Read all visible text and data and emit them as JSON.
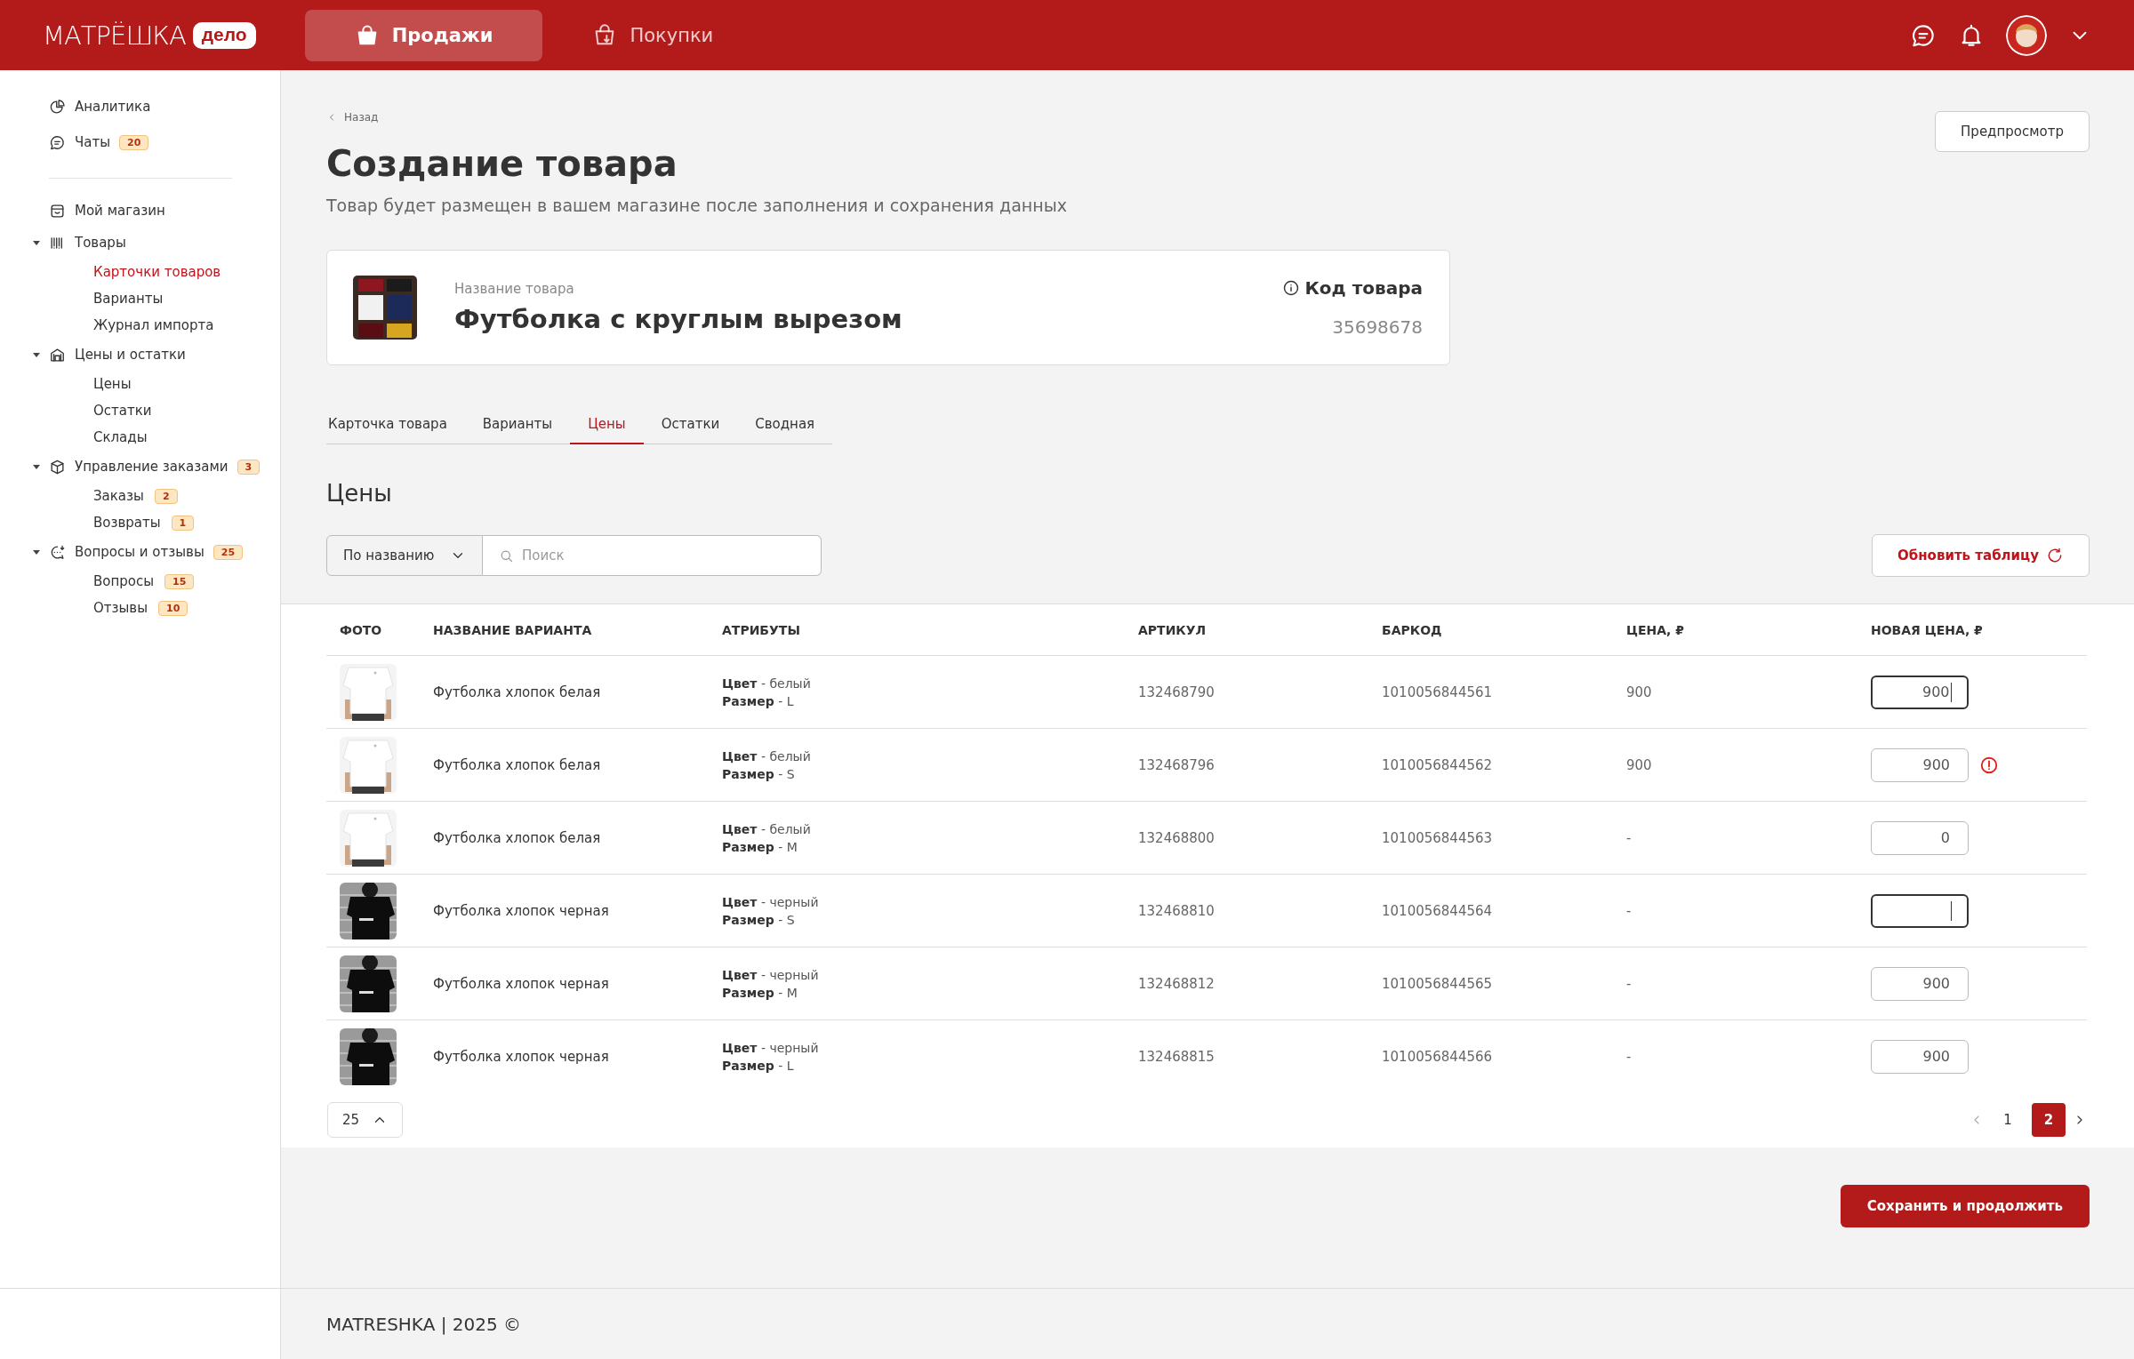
{
  "header": {
    "logo": {
      "wordmark": "МАТРЁШКА",
      "badge": "дело"
    },
    "nav": [
      {
        "label": "Продажи",
        "selected": true
      },
      {
        "label": "Покупки",
        "selected": false
      }
    ]
  },
  "sidebar": {
    "top": [
      {
        "label": "Аналитика",
        "selected": false
      },
      {
        "label": "Чаты",
        "badge": "20",
        "selected": false
      }
    ],
    "sections": [
      {
        "label": "Мой магазин",
        "selected": false
      },
      {
        "label": "Товары",
        "selected": false,
        "expanded": true,
        "children": [
          {
            "label": "Карточки товаров",
            "selected": true
          },
          {
            "label": "Варианты",
            "selected": false
          },
          {
            "label": "Журнал импорта",
            "selected": false
          }
        ]
      },
      {
        "label": "Цены и остатки",
        "selected": false,
        "expanded": true,
        "children": [
          {
            "label": "Цены",
            "selected": false
          },
          {
            "label": "Остатки",
            "selected": false
          },
          {
            "label": "Склады",
            "selected": false
          }
        ]
      },
      {
        "label": "Управление заказами",
        "badge": "3",
        "selected": false,
        "expanded": true,
        "children": [
          {
            "label": "Заказы",
            "badge": "2",
            "selected": false
          },
          {
            "label": "Возвраты",
            "badge": "1",
            "selected": false
          }
        ]
      },
      {
        "label": "Вопросы и отзывы",
        "badge": "25",
        "selected": false,
        "expanded": true,
        "children": [
          {
            "label": "Вопросы",
            "badge": "15",
            "selected": false
          },
          {
            "label": "Отзывы",
            "badge": "10",
            "selected": false
          }
        ]
      }
    ]
  },
  "page": {
    "back": "Назад",
    "title": "Создание товара",
    "subtitle": "Товар будет размещен в вашем магазине после заполнения и сохранения данных",
    "preview_button": "Предпросмотр"
  },
  "product": {
    "name_label": "Название товара",
    "name": "Футболка с круглым вырезом",
    "code_label": "Код товара",
    "code": "35698678"
  },
  "tabs": [
    {
      "label": "Карточка товара",
      "selected": false
    },
    {
      "label": "Варианты",
      "selected": false
    },
    {
      "label": "Цены",
      "selected": true
    },
    {
      "label": "Остатки",
      "selected": false
    },
    {
      "label": "Сводная",
      "selected": false
    }
  ],
  "section_title": "Цены",
  "filter": {
    "select": "По названию",
    "search": {
      "placeholder": "Поиск"
    },
    "refresh_button": "Обновить таблицу"
  },
  "table": {
    "columns": [
      "ФОТО",
      "НАЗВАНИЕ ВАРИАНТА",
      "АТРИБУТЫ",
      "АРТИКУЛ",
      "БАРКОД",
      "ЦЕНА, ₽",
      "НОВАЯ ЦЕНА, ₽"
    ],
    "rows": [
      {
        "name": "Футболка хлопок белая",
        "attributes": [
          "**Цвет** - белый",
          "**Размер** - L"
        ],
        "sku": "132468790",
        "barcode": "1010056844561",
        "price": "900",
        "new_price": "900",
        "focused": true,
        "error": false
      },
      {
        "name": "Футболка хлопок белая",
        "attributes": [
          "**Цвет** - белый",
          "**Размер** - S"
        ],
        "sku": "132468796",
        "barcode": "1010056844562",
        "price": "900",
        "new_price": "900",
        "focused": false,
        "error": true
      },
      {
        "name": "Футболка хлопок белая",
        "attributes": [
          "**Цвет** - белый",
          "**Размер** - M"
        ],
        "sku": "132468800",
        "barcode": "1010056844563",
        "price": "-",
        "new_price": "0",
        "focused": false,
        "error": false
      },
      {
        "name": "Футболка хлопок черная",
        "attributes": [
          "**Цвет** - черный",
          "**Размер** - S"
        ],
        "sku": "132468810",
        "barcode": "1010056844564",
        "price": "-",
        "focused": true,
        "error": false
      },
      {
        "name": "Футболка хлопок черная",
        "attributes": [
          "**Цвет** - черный",
          "**Размер** - M"
        ],
        "sku": "132468812",
        "barcode": "1010056844565",
        "price": "-",
        "new_price": "900",
        "focused": false,
        "error": false
      },
      {
        "name": "Футболка хлопок черная",
        "attributes": [
          "**Цвет** - черный",
          "**Размер** - L"
        ],
        "sku": "132468815",
        "barcode": "1010056844566",
        "price": "-",
        "new_price": "900",
        "focused": false,
        "error": false
      }
    ]
  },
  "pagination": {
    "page_size": "25",
    "pages": [
      {
        "label": "1",
        "selected": false
      },
      {
        "label": "2",
        "selected": true
      }
    ]
  },
  "save_button": "Сохранить и продолжить",
  "footer": "MATRESHKA | 2025 ©"
}
